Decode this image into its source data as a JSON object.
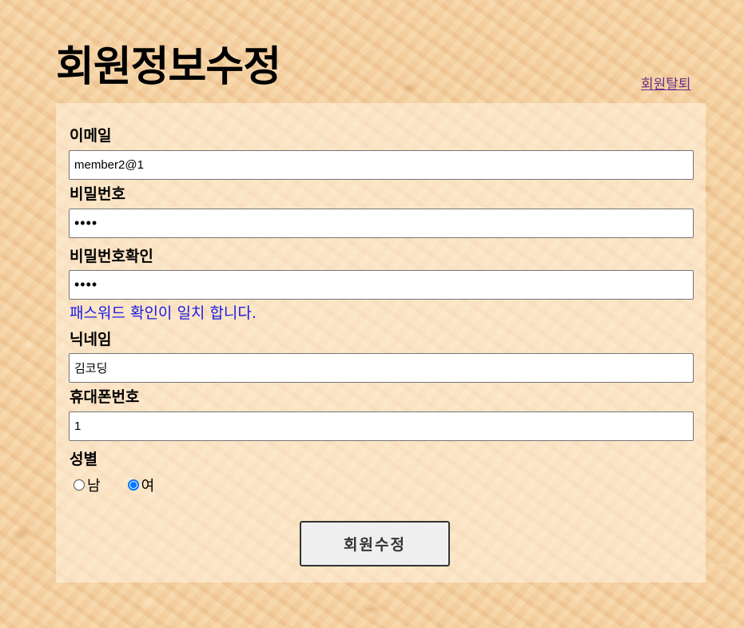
{
  "header": {
    "title": "회원정보수정",
    "withdraw_link": "회원탈퇴"
  },
  "form": {
    "email": {
      "label": "이메일",
      "value": "member2@1"
    },
    "password": {
      "label": "비밀번호",
      "value": "••••"
    },
    "password_confirm": {
      "label": "비밀번호확인",
      "value": "••••",
      "message": "패스워드 확인이 일치 합니다."
    },
    "nickname": {
      "label": "닉네임",
      "value": "김코딩"
    },
    "phone": {
      "label": "휴대폰번호",
      "value": "1"
    },
    "gender": {
      "label": "성별",
      "options": [
        {
          "label": "남",
          "checked": false
        },
        {
          "label": "여",
          "checked": true
        }
      ]
    },
    "submit_label": "회원수정"
  },
  "colors": {
    "message": "#1a1ae6",
    "radio_accent": "#0075ff",
    "link": "#6b2f8a"
  }
}
